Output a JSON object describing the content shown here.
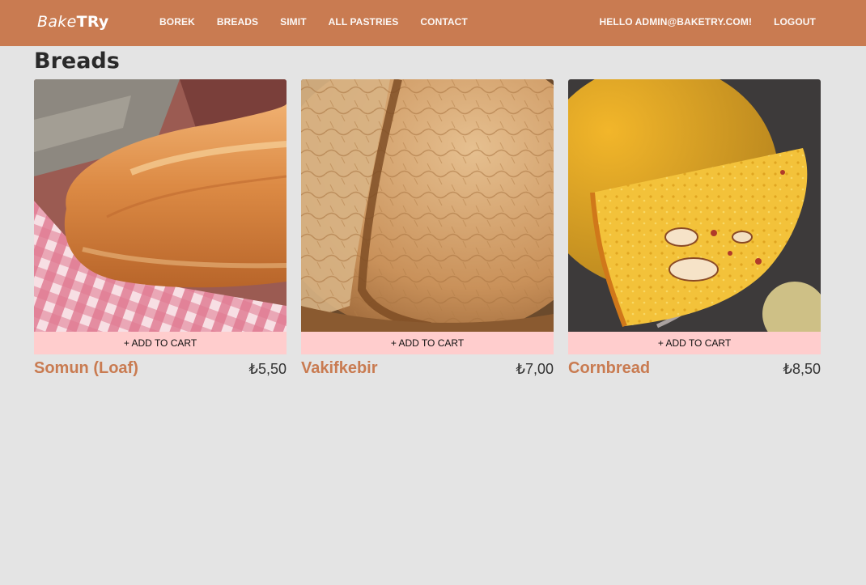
{
  "brand": {
    "part1": "Bake",
    "part2": "TRy"
  },
  "nav": {
    "left": [
      "BOREK",
      "BREADS",
      "SIMIT",
      "ALL PASTRIES",
      "CONTACT"
    ],
    "greeting": "HELLO ADMIN@BAKETRY.COM!",
    "logout": "LOGOUT"
  },
  "page": {
    "title": "Breads"
  },
  "products": [
    {
      "name": "Somun (Loaf)",
      "price": "₺5,50",
      "cta": "+ ADD TO CART",
      "image": "somun-loaf-photo"
    },
    {
      "name": "Vakifkebir",
      "price": "₺7,00",
      "cta": "+ ADD TO CART",
      "image": "vakifkebir-bread-photo"
    },
    {
      "name": "Cornbread",
      "price": "₺8,50",
      "cta": "+ ADD TO CART",
      "image": "cornbread-photo"
    }
  ],
  "colors": {
    "nav_bg": "#c97b51",
    "page_bg": "#e4e4e4",
    "button_bg": "#ffcdcd",
    "accent": "#c97b51"
  }
}
